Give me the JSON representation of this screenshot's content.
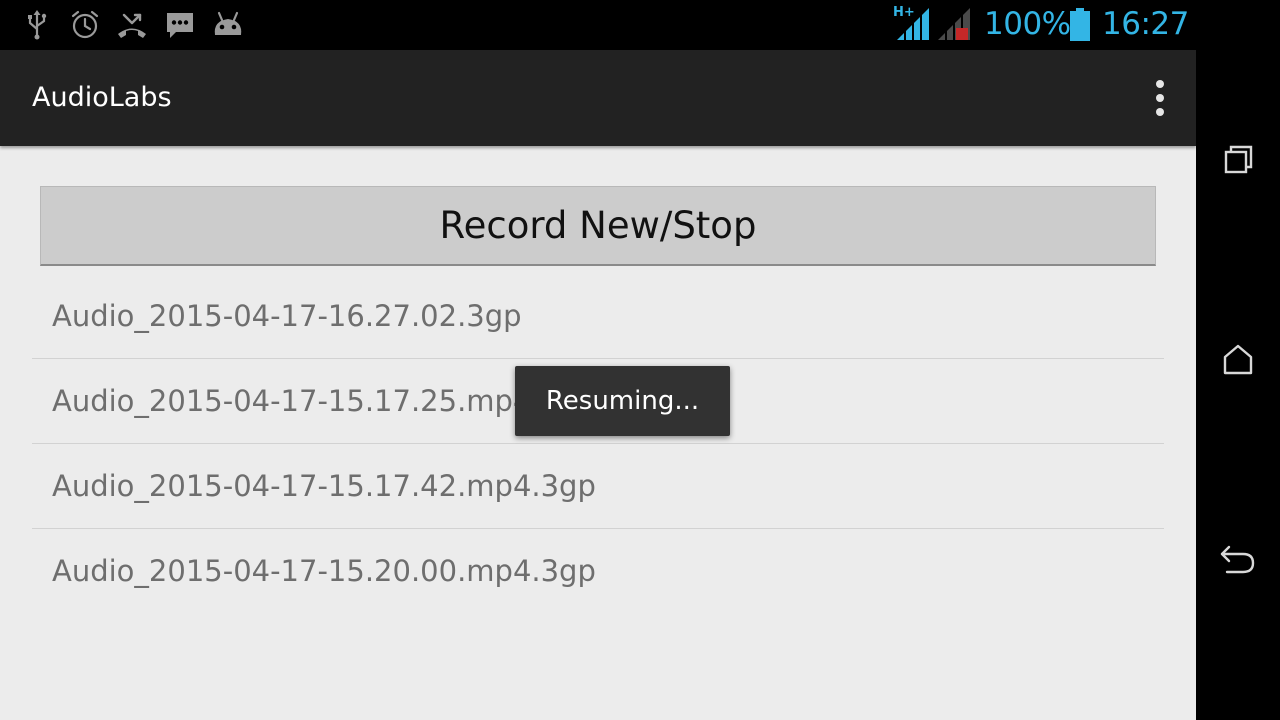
{
  "status_bar": {
    "icons": [
      "usb-icon",
      "alarm-icon",
      "missed-call-icon",
      "message-icon",
      "android-icon"
    ],
    "network_label": "H+",
    "battery_percent": "100%",
    "time": "16:27",
    "accent_color": "#33b5e5"
  },
  "action_bar": {
    "title": "AudioLabs",
    "overflow_icon": "overflow-menu-icon"
  },
  "main": {
    "record_button_label": "Record New/Stop",
    "files": [
      "Audio_2015-04-17-16.27.02.3gp",
      "Audio_2015-04-17-15.17.25.mp4.3gp",
      "Audio_2015-04-17-15.17.42.mp4.3gp",
      "Audio_2015-04-17-15.20.00.mp4.3gp"
    ]
  },
  "toast": {
    "message": "Resuming..."
  },
  "nav_bar": {
    "buttons": [
      "recent-apps-icon",
      "home-icon",
      "back-icon"
    ]
  }
}
